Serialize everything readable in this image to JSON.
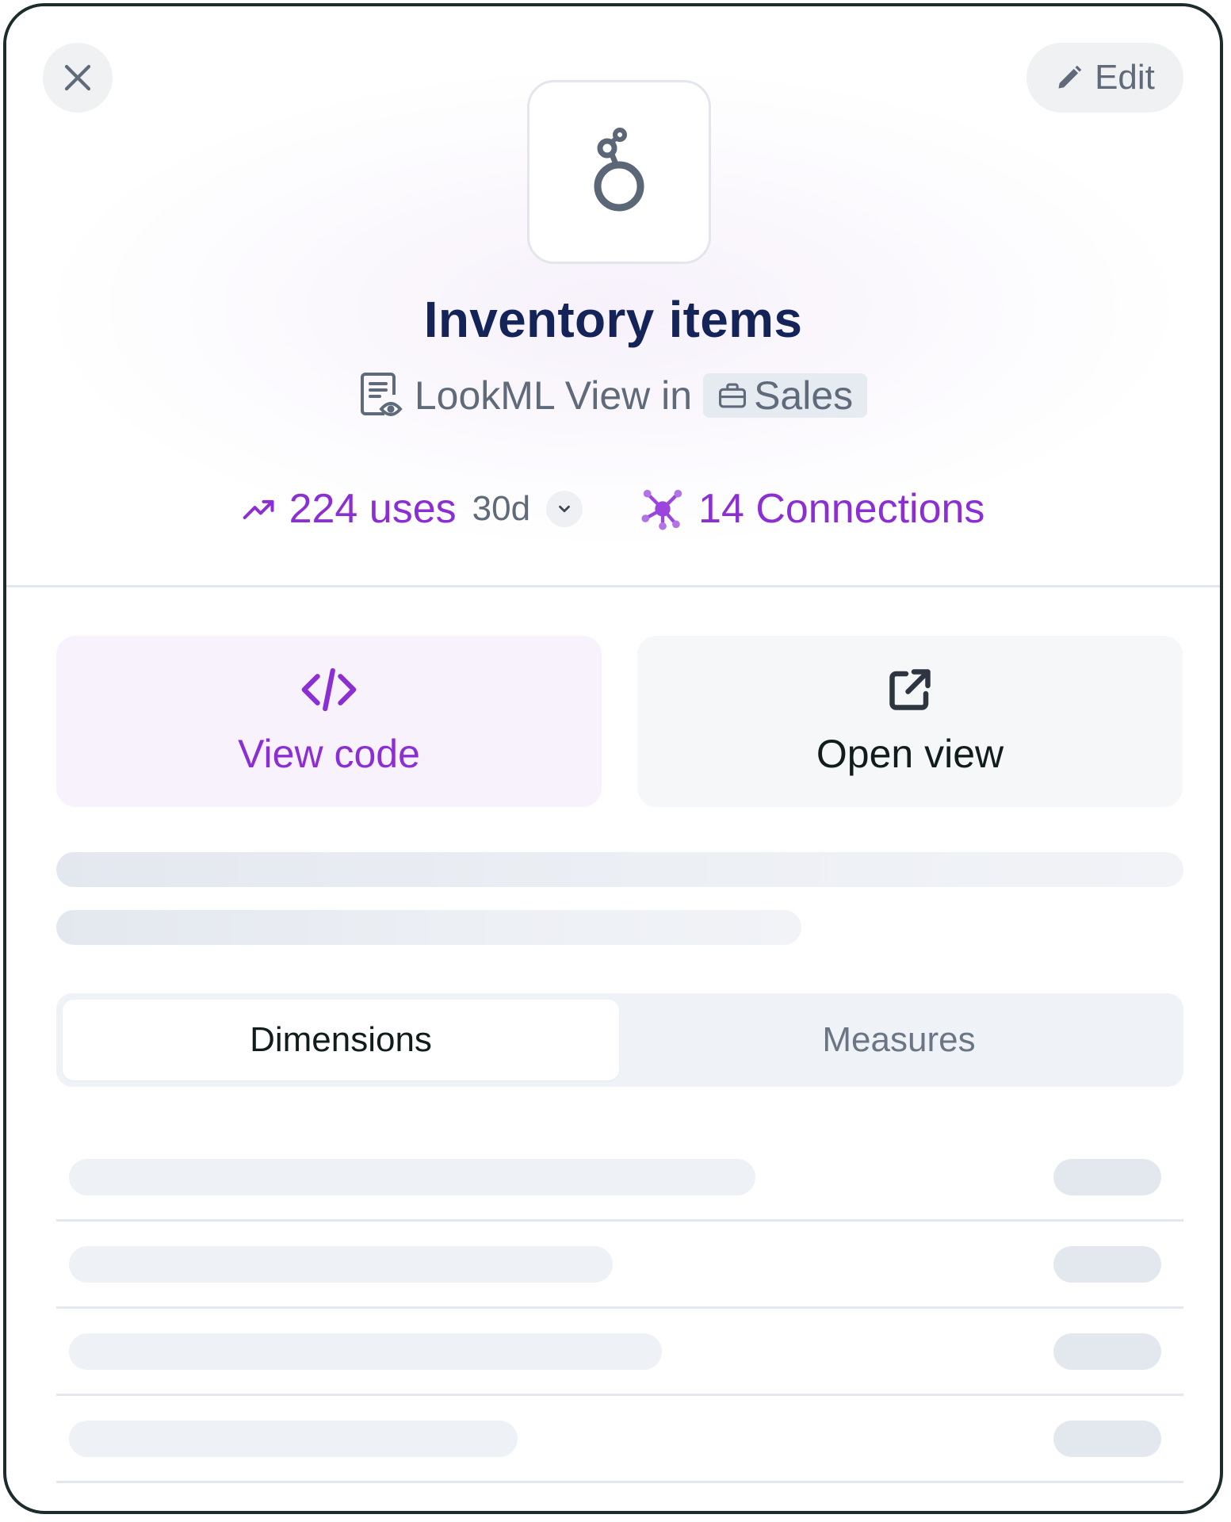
{
  "header": {
    "close_icon": "close-icon",
    "edit_label": "Edit",
    "edit_icon": "pencil-icon",
    "logo_icon": "looker-logo-icon"
  },
  "item": {
    "title": "Inventory items",
    "type_icon": "document-eye-icon",
    "type_label": "LookML View in",
    "folder_icon": "briefcase-icon",
    "folder_label": "Sales"
  },
  "stats": {
    "uses_icon": "trend-up-icon",
    "uses_label": "224 uses",
    "period_label": "30d",
    "period_dropdown_icon": "chevron-down-icon",
    "connections_icon": "network-icon",
    "connections_label": "14 Connections"
  },
  "actions": [
    {
      "label": "View code",
      "icon": "code-icon"
    },
    {
      "label": "Open view",
      "icon": "external-link-icon"
    }
  ],
  "tabs": [
    {
      "label": "Dimensions",
      "selected": true
    },
    {
      "label": "Measures",
      "selected": false
    }
  ],
  "colors": {
    "accent": "#8b2fd4",
    "title": "#142358",
    "muted": "#5f6b7a",
    "border": "#1c2b2b"
  }
}
